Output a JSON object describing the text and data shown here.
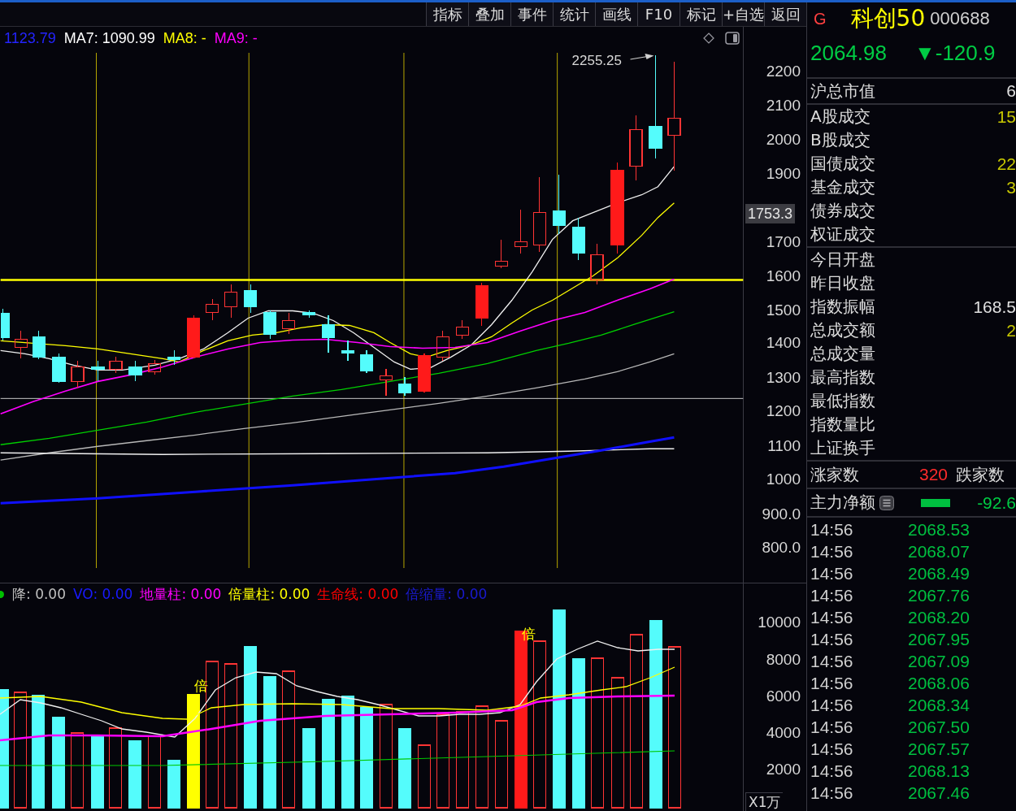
{
  "toolbar": {
    "buttons": [
      "指标",
      "叠加",
      "事件",
      "统计",
      "画线",
      "F10",
      "标记",
      "+自选",
      "返回"
    ]
  },
  "price_chart": {
    "legend": [
      {
        "text": "1123.79",
        "color": "#2424ff"
      },
      {
        "text": "MA7: 1090.99",
        "color": "#ffffff"
      },
      {
        "text": "MA8: -",
        "color": "#ffff00"
      },
      {
        "text": "MA9: -",
        "color": "#ff00ff"
      }
    ],
    "peak_label": "2255.25",
    "axis_labels": [
      "2200",
      "2100",
      "2000",
      "1900",
      "1700",
      "1600",
      "1500",
      "1400",
      "1300",
      "1200",
      "1100",
      "1000",
      "900.0",
      "800.0"
    ],
    "price_tag": "1753.3"
  },
  "volume_chart": {
    "legend": [
      {
        "text": "降: 0.00",
        "color": "#c0c0c0"
      },
      {
        "text": "VO: 0.00",
        "color": "#1a1aff"
      },
      {
        "text": "地量柱: 0.00",
        "color": "#ff00ff"
      },
      {
        "text": "倍量柱: 0.00",
        "color": "#ffff00"
      },
      {
        "text": "生命线: 0.00",
        "color": "#ff0000"
      },
      {
        "text": "倍缩量: 0.00",
        "color": "#1a1ad0"
      }
    ],
    "markers": [
      "倍",
      "倍"
    ],
    "axis_labels": [
      "10000",
      "8000",
      "6000",
      "4000",
      "2000"
    ],
    "unit": "X1万"
  },
  "quote": {
    "flag": "G",
    "name": "科创50",
    "code": "000688",
    "price": "2064.98",
    "change": "▼-120.9"
  },
  "market_value": {
    "label": "沪总市值",
    "value": "6"
  },
  "turnover": [
    {
      "label": "A股成交",
      "value": "15",
      "color": "#c8c800"
    },
    {
      "label": "B股成交"
    },
    {
      "label": "国债成交",
      "value": "22",
      "color": "#c8c800"
    },
    {
      "label": "基金成交",
      "value": "3",
      "color": "#c8c800"
    },
    {
      "label": "债券成交"
    },
    {
      "label": "权证成交"
    }
  ],
  "index_stats": [
    {
      "label": "今日开盘"
    },
    {
      "label": "昨日收盘"
    },
    {
      "label": "指数振幅",
      "value": "168.5",
      "color": "#e0e0e0"
    },
    {
      "label": "总成交额",
      "value": "2",
      "color": "#c8c800"
    },
    {
      "label": "总成交量"
    },
    {
      "label": "最高指数"
    },
    {
      "label": "最低指数"
    },
    {
      "label": "指数量比"
    },
    {
      "label": "上证换手"
    }
  ],
  "breadth": {
    "up_label": "涨家数",
    "up_count": "320",
    "down_label": "跌家数"
  },
  "net_flow": {
    "label": "主力净额",
    "value": "-92.6"
  },
  "ticks": [
    {
      "time": "14:56",
      "price": "2068.53"
    },
    {
      "time": "14:56",
      "price": "2068.07"
    },
    {
      "time": "14:56",
      "price": "2068.49"
    },
    {
      "time": "14:56",
      "price": "2067.76"
    },
    {
      "time": "14:56",
      "price": "2068.20"
    },
    {
      "time": "14:56",
      "price": "2067.95"
    },
    {
      "time": "14:56",
      "price": "2067.09"
    },
    {
      "time": "14:56",
      "price": "2068.06"
    },
    {
      "time": "14:56",
      "price": "2068.34"
    },
    {
      "time": "14:56",
      "price": "2067.50"
    },
    {
      "time": "14:56",
      "price": "2067.57"
    },
    {
      "time": "14:56",
      "price": "2068.13"
    },
    {
      "time": "14:56",
      "price": "2067.46"
    }
  ]
}
